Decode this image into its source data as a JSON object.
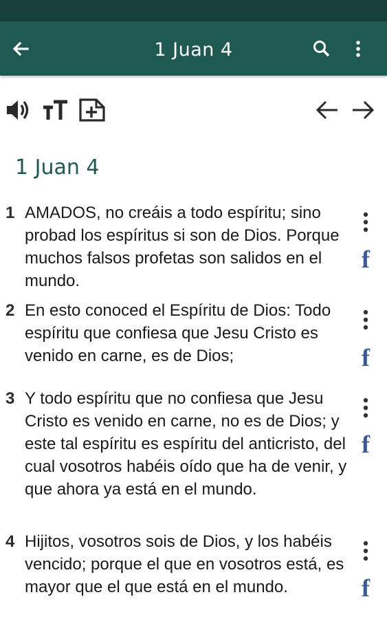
{
  "app_bar": {
    "title": "1 Juan 4",
    "icons": [
      "back-arrow-icon",
      "search-icon",
      "more-vert-icon"
    ]
  },
  "toolbar": {
    "icons": [
      "speaker-icon",
      "text-size-icon",
      "add-note-icon",
      "prev-arrow-icon",
      "next-arrow-icon"
    ]
  },
  "chapter": {
    "title": "1 Juan 4"
  },
  "verses": [
    {
      "num": "1",
      "text": "AMADOS, no creáis a todo espíritu; sino probad los espíritus si son de Dios. Porque muchos falsos profetas son salidos en el mundo."
    },
    {
      "num": "2",
      "text": "En esto conoced el Espíritu de Dios: Todo espíritu que confiesa que Jesu Cristo es venido en carne, es de Dios;"
    },
    {
      "num": "3",
      "text": "Y todo espíritu que no confiesa que Jesu Cristo es venido en carne, no es de Dios; y este tal espíritu es espíritu del anticristo, del cual vosotros habéis oído que ha de venir, y que ahora ya está en el mundo."
    },
    {
      "num": "4",
      "text": "Hijitos, vosotros sois de Dios, y los habéis vencido; porque el que en vosotros está, es mayor que el que está en el mundo."
    }
  ],
  "facebook_glyph": "f",
  "colors": {
    "status_bar": "#17403a",
    "app_bar": "#1e5a51",
    "accent": "#1e5a51",
    "facebook": "#3b5998"
  }
}
